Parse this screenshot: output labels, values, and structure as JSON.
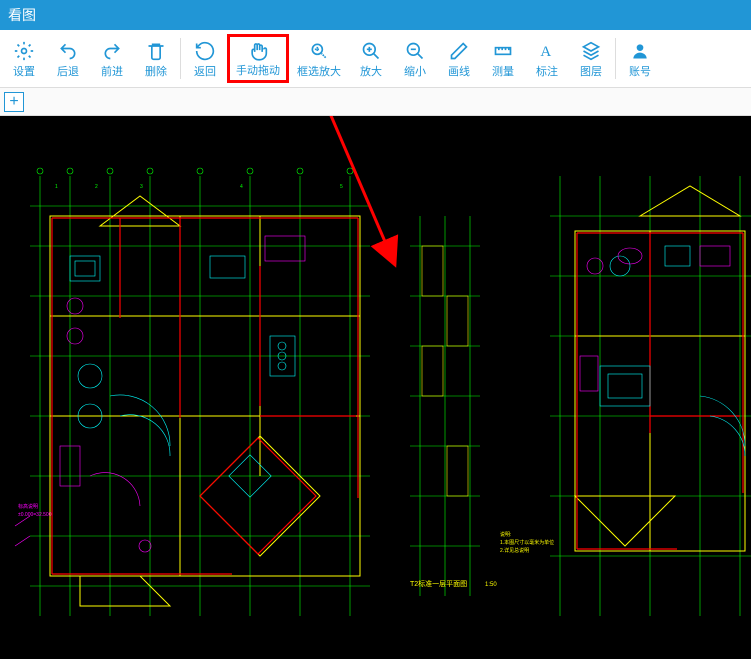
{
  "title_bar": {
    "text": "看图"
  },
  "toolbar": {
    "settings": "设置",
    "back": "后退",
    "forward": "前进",
    "delete": "删除",
    "return": "返回",
    "pan": "手动拖动",
    "zoom_window": "框选放大",
    "zoom_in": "放大",
    "zoom_out": "缩小",
    "line": "画线",
    "measure": "测量",
    "annotate": "标注",
    "layer": "图层",
    "account": "账号"
  },
  "tab_bar": {
    "add": "+"
  },
  "canvas": {
    "floor_plan_label": "T2标准一层平面图",
    "scale": "1:50"
  }
}
